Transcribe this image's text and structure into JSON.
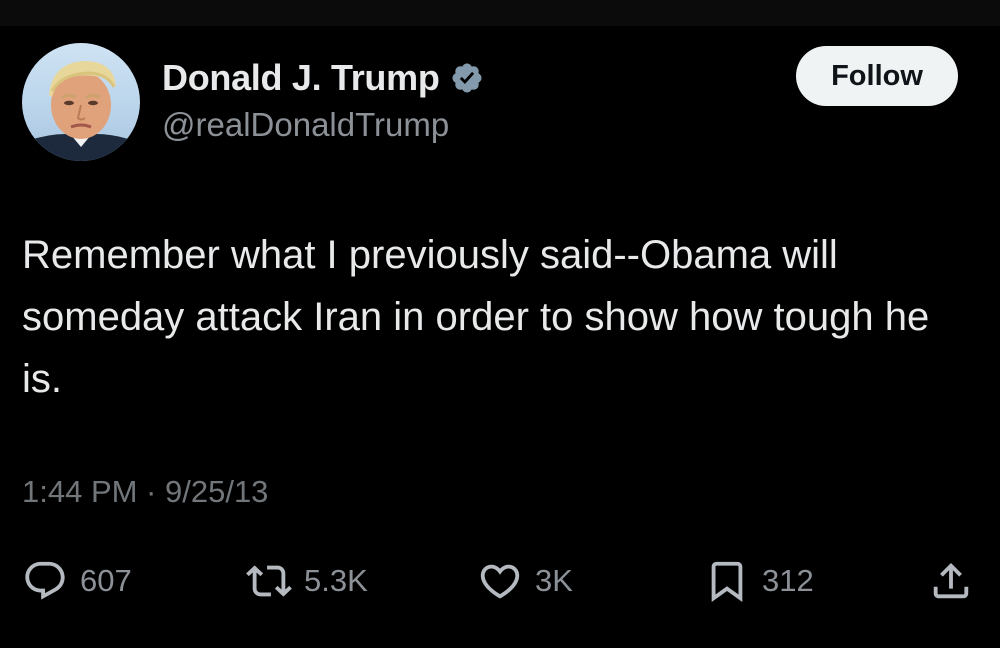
{
  "tweet": {
    "author": {
      "display_name": "Donald J. Trump",
      "handle": "@realDonaldTrump",
      "verified": true
    },
    "follow_label": "Follow",
    "text": "Remember what I previously said--Obama will someday attack Iran in order to show how tough he is.",
    "timestamp": "1:44 PM · 9/25/13",
    "actions": {
      "replies": "607",
      "reposts": "5.3K",
      "likes": "3K",
      "bookmarks": "312"
    }
  },
  "icons": {
    "verified": "verified-badge-icon",
    "reply": "reply-icon",
    "repost": "repost-icon",
    "like": "heart-icon",
    "bookmark": "bookmark-icon",
    "share": "share-icon"
  },
  "colors": {
    "background": "#000000",
    "text_primary": "#e7e9ea",
    "text_secondary": "#71767b",
    "follow_bg": "#eff3f4",
    "verified_badge": "#829aab"
  }
}
